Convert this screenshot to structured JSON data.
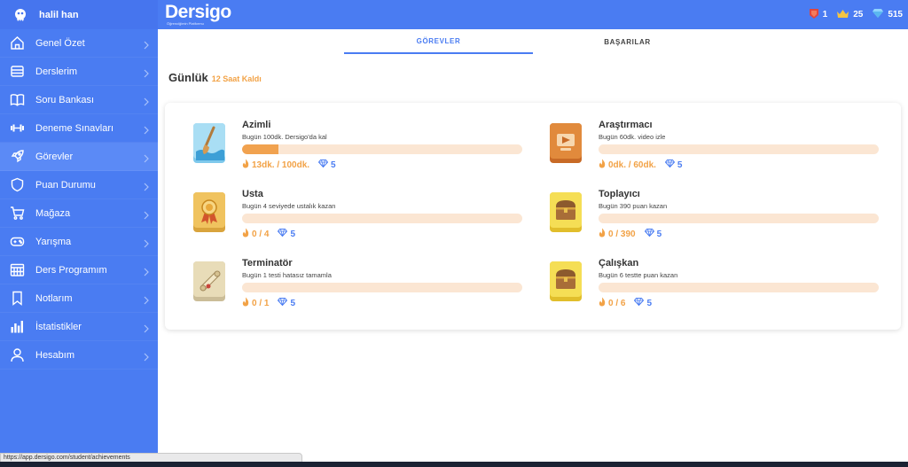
{
  "user": {
    "name": "halil han"
  },
  "brand": {
    "name": "Dersigo",
    "tagline": "Öğrenciğimin Platformu"
  },
  "stats": [
    {
      "icon": "red-badge-icon",
      "value": "1"
    },
    {
      "icon": "crown-icon",
      "value": "25"
    },
    {
      "icon": "diamond-icon",
      "value": "515"
    }
  ],
  "sidebar": {
    "items": [
      {
        "label": "Genel Özet",
        "icon": "home-icon"
      },
      {
        "label": "Derslerim",
        "icon": "desk-icon"
      },
      {
        "label": "Soru Bankası",
        "icon": "book-icon"
      },
      {
        "label": "Deneme Sınavları",
        "icon": "dumbbell-icon"
      },
      {
        "label": "Görevler",
        "icon": "rocket-icon"
      },
      {
        "label": "Puan Durumu",
        "icon": "shield-icon"
      },
      {
        "label": "Mağaza",
        "icon": "cart-icon"
      },
      {
        "label": "Yarışma",
        "icon": "gamepad-icon"
      },
      {
        "label": "Ders Programım",
        "icon": "calendar-icon"
      },
      {
        "label": "Notlarım",
        "icon": "bookmark-icon"
      },
      {
        "label": "İstatistikler",
        "icon": "bar-chart-icon"
      },
      {
        "label": "Hesabım",
        "icon": "user-icon"
      }
    ]
  },
  "tabs": {
    "tasks": "GÖREVLER",
    "achievements": "BAŞARILAR"
  },
  "section": {
    "title": "Günlük",
    "time_left": "12 Saat Kaldı"
  },
  "tasks": [
    {
      "title": "Azimli",
      "desc": "Bugün 100dk. Dersigo'da kal",
      "progress": "13dk. / 100dk.",
      "progress_fraction": 0.13,
      "gems": "5",
      "icon": "oar-icon"
    },
    {
      "title": "Araştırmacı",
      "desc": "Bugün 60dk. video izle",
      "progress": "0dk. / 60dk.",
      "progress_fraction": 0,
      "gems": "5",
      "icon": "video-icon"
    },
    {
      "title": "Usta",
      "desc": "Bugün 4 seviyede ustalık kazan",
      "progress": "0 / 4",
      "progress_fraction": 0,
      "gems": "5",
      "icon": "medal-icon"
    },
    {
      "title": "Toplayıcı",
      "desc": "Bugün 390 puan kazan",
      "progress": "0 / 390",
      "progress_fraction": 0,
      "gems": "5",
      "icon": "treasure-chest-icon"
    },
    {
      "title": "Terminatör",
      "desc": "Bugün 1 testi hatasız tamamla",
      "progress": "0 / 1",
      "progress_fraction": 0,
      "gems": "5",
      "icon": "scroll-icon"
    },
    {
      "title": "Çalışkan",
      "desc": "Bugün 6 testte puan kazan",
      "progress": "0 / 6",
      "progress_fraction": 0,
      "gems": "5",
      "icon": "treasure-chest-icon"
    }
  ],
  "status_url": "https://app.dersigo.com/student/achievements",
  "colors": {
    "primary": "#4a7cf2",
    "accent": "#f2a246",
    "bar_bg": "#fbe6d3"
  }
}
